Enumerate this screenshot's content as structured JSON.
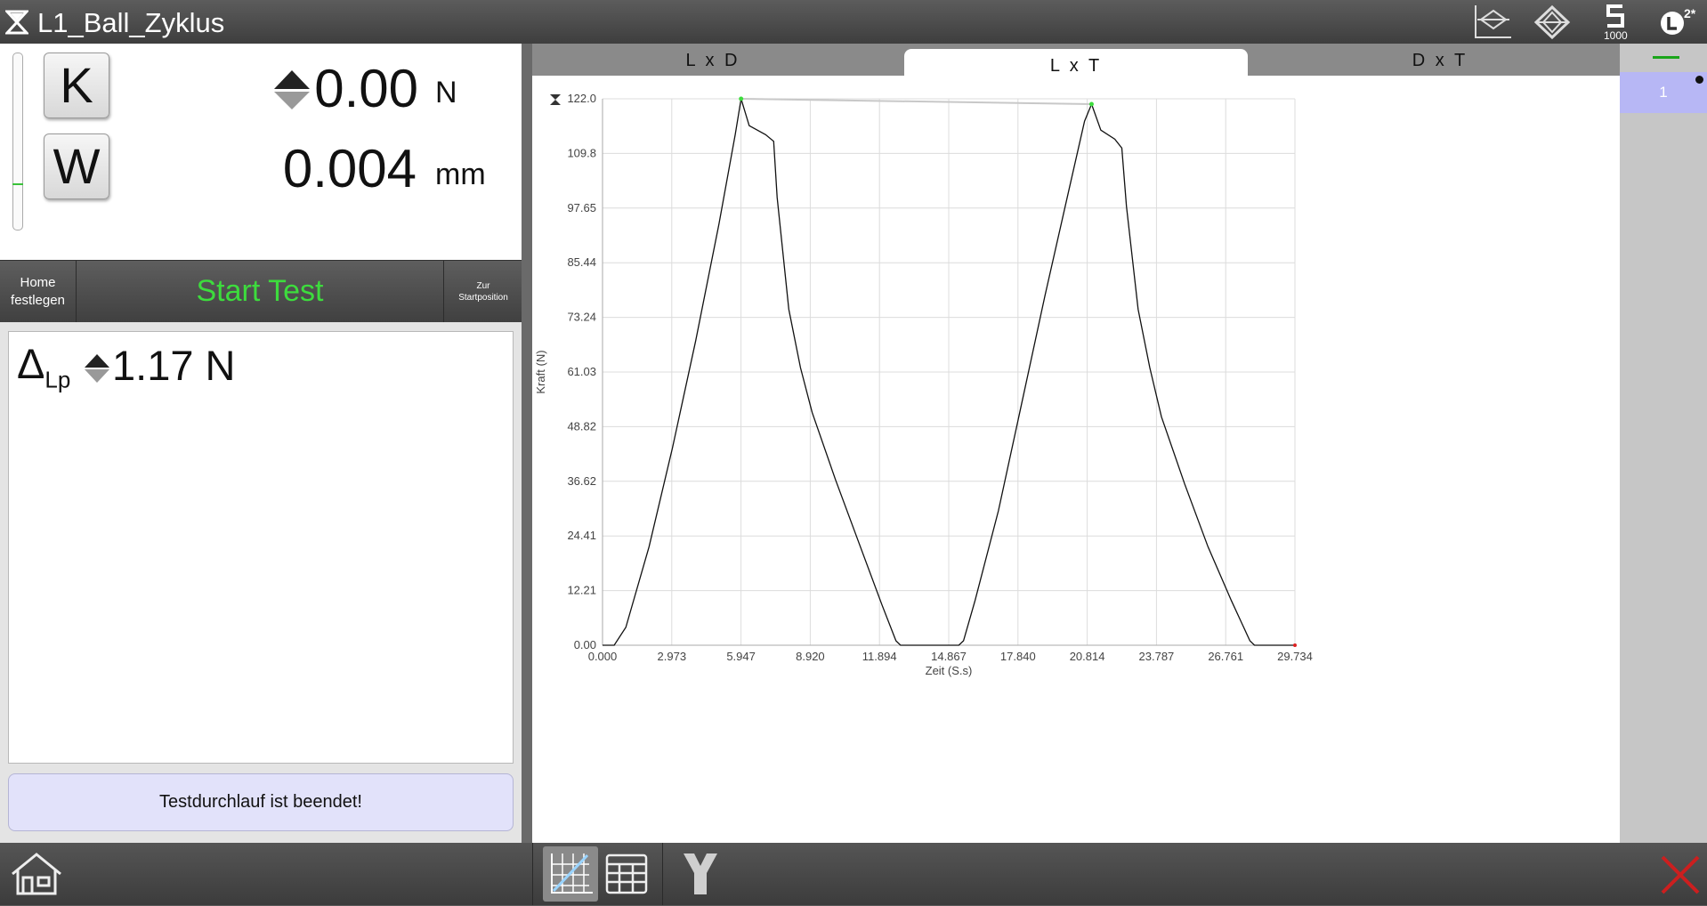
{
  "title": "L1_Ball_Zyklus",
  "toolbar": {
    "speed_value": "1000",
    "sample_label": "2*"
  },
  "readouts": {
    "k_label": "K",
    "w_label": "W",
    "force_value": "0.00",
    "force_unit": "N",
    "distance_value": "0.004",
    "distance_unit": "mm"
  },
  "buttons": {
    "home_set_line1": "Home",
    "home_set_line2": "festlegen",
    "start_test": "Start Test",
    "zur_line1": "Zur",
    "zur_line2": "Startposition"
  },
  "results": {
    "delta_symbol": "Δ",
    "delta_sub": "Lp",
    "delta_value": "1.17 N",
    "status": "Testdurchlauf ist beendet!"
  },
  "tabs": [
    {
      "label": "L x D",
      "active": false
    },
    {
      "label": "L x T",
      "active": true
    },
    {
      "label": "D x T",
      "active": false
    }
  ],
  "sample_list": {
    "items": [
      "1"
    ]
  },
  "colors": {
    "start_green": "#3ddc3d",
    "status_bg": "#e2e2fa",
    "selected_row": "#b7b7f5",
    "close_red": "#cc1f1f"
  },
  "chart_data": {
    "type": "line",
    "xlabel": "Zeit (S.s)",
    "ylabel": "Kraft (N)",
    "xlim": [
      0,
      29.734
    ],
    "ylim": [
      0,
      122.0
    ],
    "x_ticks": [
      "0.000",
      "2.973",
      "5.947",
      "8.920",
      "11.894",
      "14.867",
      "17.840",
      "20.814",
      "23.787",
      "26.761",
      "29.734"
    ],
    "y_ticks": [
      "0.00",
      "12.21",
      "24.41",
      "36.62",
      "48.82",
      "61.03",
      "73.24",
      "85.44",
      "97.65",
      "109.8",
      "122.0"
    ],
    "grid": true,
    "peaks": [
      {
        "x": 5.95,
        "y": 122.0
      },
      {
        "x": 21.0,
        "y": 120.8
      }
    ],
    "series": [
      {
        "values": [
          [
            0.0,
            0.0
          ],
          [
            0.5,
            0.0
          ],
          [
            1.0,
            4.0
          ],
          [
            2.0,
            22.0
          ],
          [
            3.0,
            44.0
          ],
          [
            4.0,
            68.0
          ],
          [
            5.0,
            94.0
          ],
          [
            5.7,
            114.0
          ],
          [
            5.95,
            122.0
          ],
          [
            6.3,
            116.0
          ],
          [
            7.0,
            114.0
          ],
          [
            7.35,
            112.5
          ],
          [
            7.5,
            100.0
          ],
          [
            8.0,
            75.0
          ],
          [
            8.5,
            62.0
          ],
          [
            9.0,
            52.0
          ],
          [
            10.0,
            37.0
          ],
          [
            11.0,
            23.0
          ],
          [
            12.0,
            9.0
          ],
          [
            12.6,
            1.0
          ],
          [
            12.8,
            0.0
          ],
          [
            15.3,
            0.0
          ],
          [
            15.5,
            1.0
          ],
          [
            16.0,
            10.0
          ],
          [
            17.0,
            30.0
          ],
          [
            18.0,
            54.0
          ],
          [
            19.0,
            78.0
          ],
          [
            20.0,
            101.0
          ],
          [
            20.7,
            117.0
          ],
          [
            21.0,
            120.8
          ],
          [
            21.4,
            115.0
          ],
          [
            22.0,
            113.0
          ],
          [
            22.3,
            111.0
          ],
          [
            22.5,
            98.0
          ],
          [
            23.0,
            75.0
          ],
          [
            23.5,
            62.0
          ],
          [
            24.0,
            51.0
          ],
          [
            25.0,
            36.0
          ],
          [
            26.0,
            22.0
          ],
          [
            27.0,
            10.0
          ],
          [
            27.8,
            1.0
          ],
          [
            28.0,
            0.0
          ],
          [
            29.734,
            0.0
          ]
        ]
      }
    ]
  }
}
